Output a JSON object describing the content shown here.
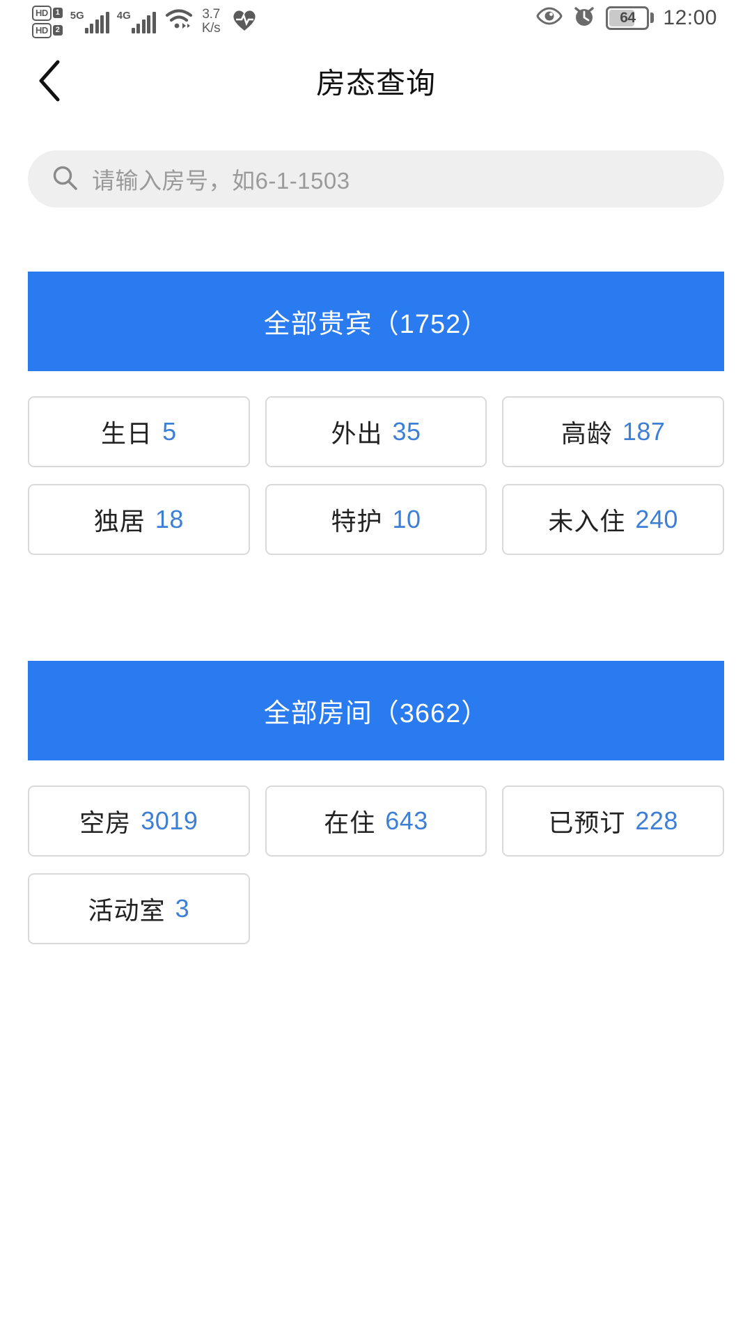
{
  "statusbar": {
    "hd_label_1": "HD",
    "hd_index_1": "1",
    "hd_label_2": "HD",
    "hd_index_2": "2",
    "sim1_network": "5G",
    "sim2_network": "4G",
    "net_speed_value": "3.7",
    "net_speed_unit": "K/s",
    "battery_level": "64",
    "time": "12:00"
  },
  "navbar": {
    "title": "房态查询"
  },
  "search": {
    "placeholder": "请输入房号，如6-1-1503",
    "value": ""
  },
  "colors": {
    "accent_blue": "#2a7af0",
    "value_blue": "#3d7fd6",
    "card_border": "#d9d9d9",
    "search_bg": "#efefef"
  },
  "sections": [
    {
      "banner": "全部贵宾（1752）",
      "banner_name": "全部贵宾",
      "banner_count": "1752",
      "cards": [
        {
          "label": "生日",
          "value": "5"
        },
        {
          "label": "外出",
          "value": "35"
        },
        {
          "label": "高龄",
          "value": "187"
        },
        {
          "label": "独居",
          "value": "18"
        },
        {
          "label": "特护",
          "value": "10"
        },
        {
          "label": "未入住",
          "value": "240"
        }
      ]
    },
    {
      "banner": "全部房间（3662）",
      "banner_name": "全部房间",
      "banner_count": "3662",
      "cards": [
        {
          "label": "空房",
          "value": "3019"
        },
        {
          "label": "在住",
          "value": "643"
        },
        {
          "label": "已预订",
          "value": "228"
        },
        {
          "label": "活动室",
          "value": "3"
        }
      ]
    }
  ]
}
